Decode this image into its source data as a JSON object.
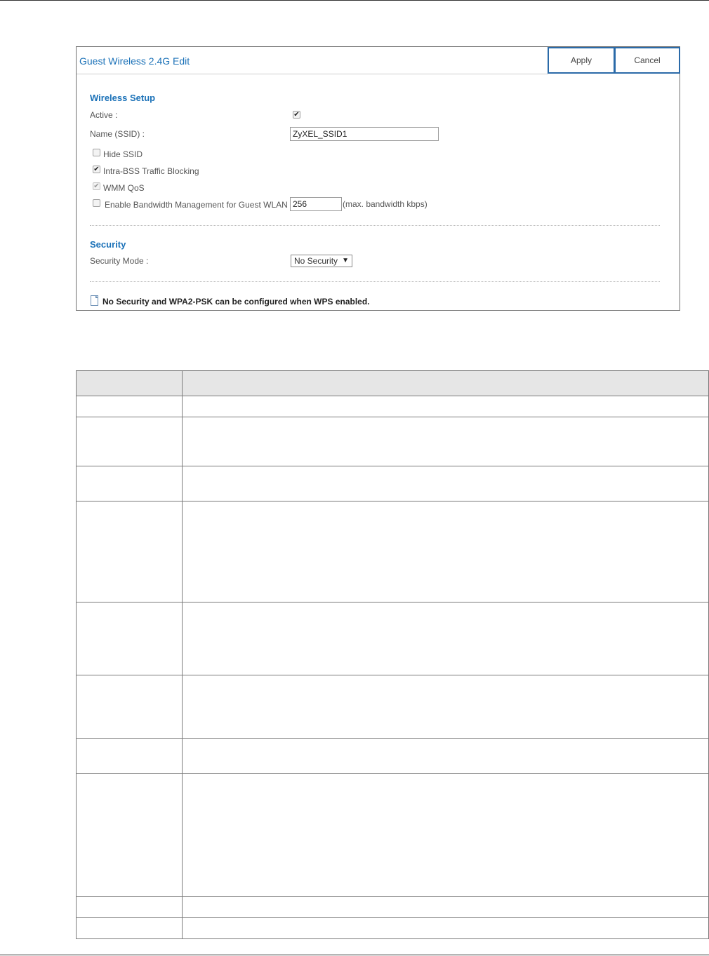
{
  "dialog": {
    "title": "Guest Wireless 2.4G Edit",
    "apply_label": "Apply",
    "cancel_label": "Cancel"
  },
  "wireless_setup": {
    "section_title": "Wireless Setup",
    "active_label": "Active :",
    "active_checked": true,
    "ssid_label": "Name (SSID) :",
    "ssid_value": "ZyXEL_SSID1",
    "hide_ssid_label": "Hide SSID",
    "hide_ssid_checked": false,
    "intra_bss_label": "Intra-BSS Traffic Blocking",
    "intra_bss_checked": true,
    "wmm_qos_label": "WMM QoS",
    "wmm_qos_checked": true,
    "bandwidth_label": "Enable Bandwidth Management for Guest WLAN",
    "bandwidth_checked": false,
    "bandwidth_value": "256",
    "bandwidth_unit": "(max. bandwidth kbps)"
  },
  "security": {
    "section_title": "Security",
    "mode_label": "Security Mode :",
    "mode_value": "No Security"
  },
  "note": {
    "text": "No Security and WPA2-PSK can be configured when WPS enabled."
  },
  "colors": {
    "accent": "#1c72b8",
    "button_border": "#2a6aa8",
    "table_header": "#e6e6e6"
  }
}
